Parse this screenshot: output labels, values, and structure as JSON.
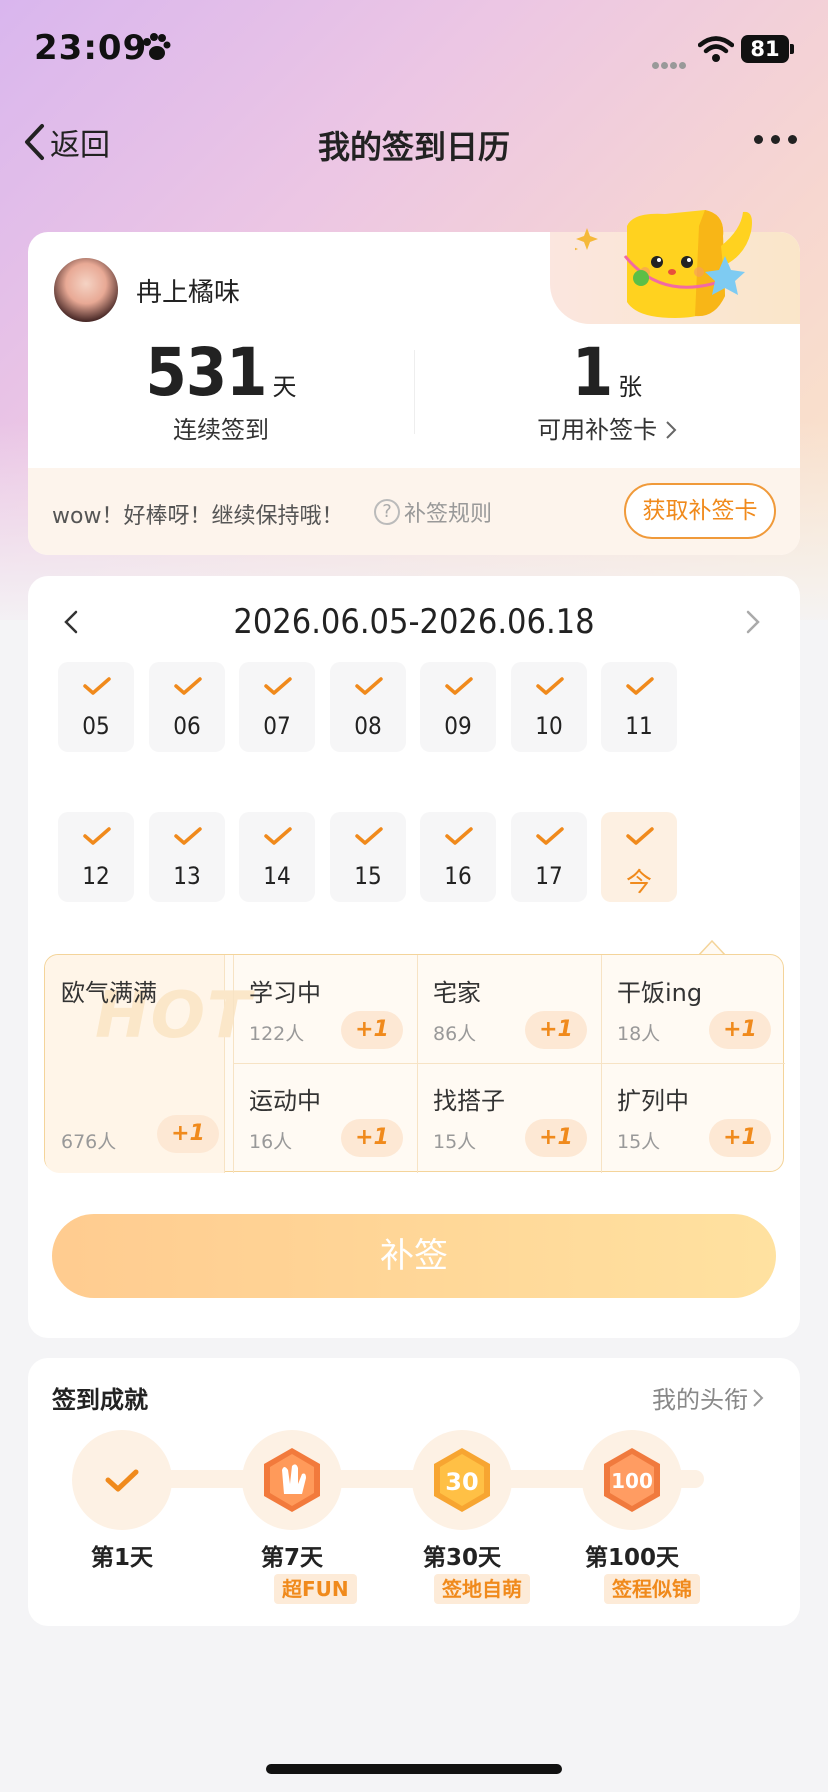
{
  "status_bar": {
    "time": "23:09",
    "battery": "81"
  },
  "nav": {
    "back_label": "返回",
    "title": "我的签到日历"
  },
  "profile": {
    "username": "冉上橘味",
    "streak_value": "531",
    "streak_unit": "天",
    "streak_label": "连续签到",
    "cards_value": "1",
    "cards_unit": "张",
    "cards_label": "可用补签卡",
    "footer_text": "wow！好棒呀！继续保持哦！",
    "rules_label": "补签规则",
    "get_card_label": "获取补签卡"
  },
  "calendar": {
    "range": "2026.06.05-2026.06.18",
    "days": [
      {
        "label": "05",
        "checked": true
      },
      {
        "label": "06",
        "checked": true
      },
      {
        "label": "07",
        "checked": true
      },
      {
        "label": "08",
        "checked": true
      },
      {
        "label": "09",
        "checked": true
      },
      {
        "label": "10",
        "checked": true
      },
      {
        "label": "11",
        "checked": true
      },
      {
        "label": "12",
        "checked": true
      },
      {
        "label": "13",
        "checked": true
      },
      {
        "label": "14",
        "checked": true
      },
      {
        "label": "15",
        "checked": true
      },
      {
        "label": "16",
        "checked": true
      },
      {
        "label": "17",
        "checked": true
      },
      {
        "label": "今",
        "checked": true,
        "today": true
      }
    ]
  },
  "moods": {
    "hot_watermark": "HOT",
    "featured": {
      "name": "欧气满满",
      "count": "676人",
      "plus": "+1"
    },
    "items": [
      {
        "name": "学习中",
        "count": "122人",
        "plus": "+1"
      },
      {
        "name": "宅家",
        "count": "86人",
        "plus": "+1"
      },
      {
        "name": "干饭ing",
        "count": "18人",
        "plus": "+1"
      },
      {
        "name": "运动中",
        "count": "16人",
        "plus": "+1"
      },
      {
        "name": "找搭子",
        "count": "15人",
        "plus": "+1"
      },
      {
        "name": "扩列中",
        "count": "15人",
        "plus": "+1"
      }
    ]
  },
  "resign_label": "补签",
  "achievements": {
    "title": "签到成就",
    "my_title_label": "我的头衔",
    "milestones": [
      {
        "label": "第1天",
        "tag": ""
      },
      {
        "label": "第7天",
        "tag": "超FUN"
      },
      {
        "label": "第30天",
        "tag": "签地自萌"
      },
      {
        "label": "第100天",
        "tag": "签程似锦"
      }
    ]
  },
  "colors": {
    "accent": "#f08a1c",
    "button_start": "#ffc98a",
    "button_end": "#ffe09b"
  }
}
